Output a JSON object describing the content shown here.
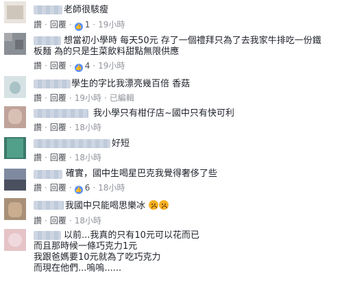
{
  "actions": {
    "like": "讚",
    "reply": "回覆",
    "sep": "·"
  },
  "comments": [
    {
      "text": "老師很駭瘦",
      "likes": "1",
      "time": "19小時"
    },
    {
      "text": "想當初小學時 每天50元 存了一個禮拜只為了去我家牛排吃一份鐵\n板麵 為的只是生菜飲料甜點無限供應",
      "likes": "4",
      "time": "19小時"
    },
    {
      "text": "學生的字比我漂亮幾百倍 香菇",
      "likes": "",
      "time": "19小時",
      "edited": "已編輯"
    },
    {
      "text": "我小學只有柑仔店~國中只有快可利",
      "likes": "",
      "time": "18小時"
    },
    {
      "text": "好短",
      "likes": "",
      "time": "18小時"
    },
    {
      "text": "確實，國中生喝星巴克我覺得奢侈了些",
      "likes": "6",
      "time": "18小時"
    },
    {
      "text": "我國中只能喝思樂冰",
      "likes": "",
      "time": "18小時",
      "emoji": "crying-emoji"
    },
    {
      "text": "以前...我真的只有10元可以花而已\n而且那時候一條巧克力1元\n我跟爸媽要10元就為了吃巧克力\n而現在他們...嗚嗚......",
      "likes": "",
      "time": ""
    }
  ]
}
